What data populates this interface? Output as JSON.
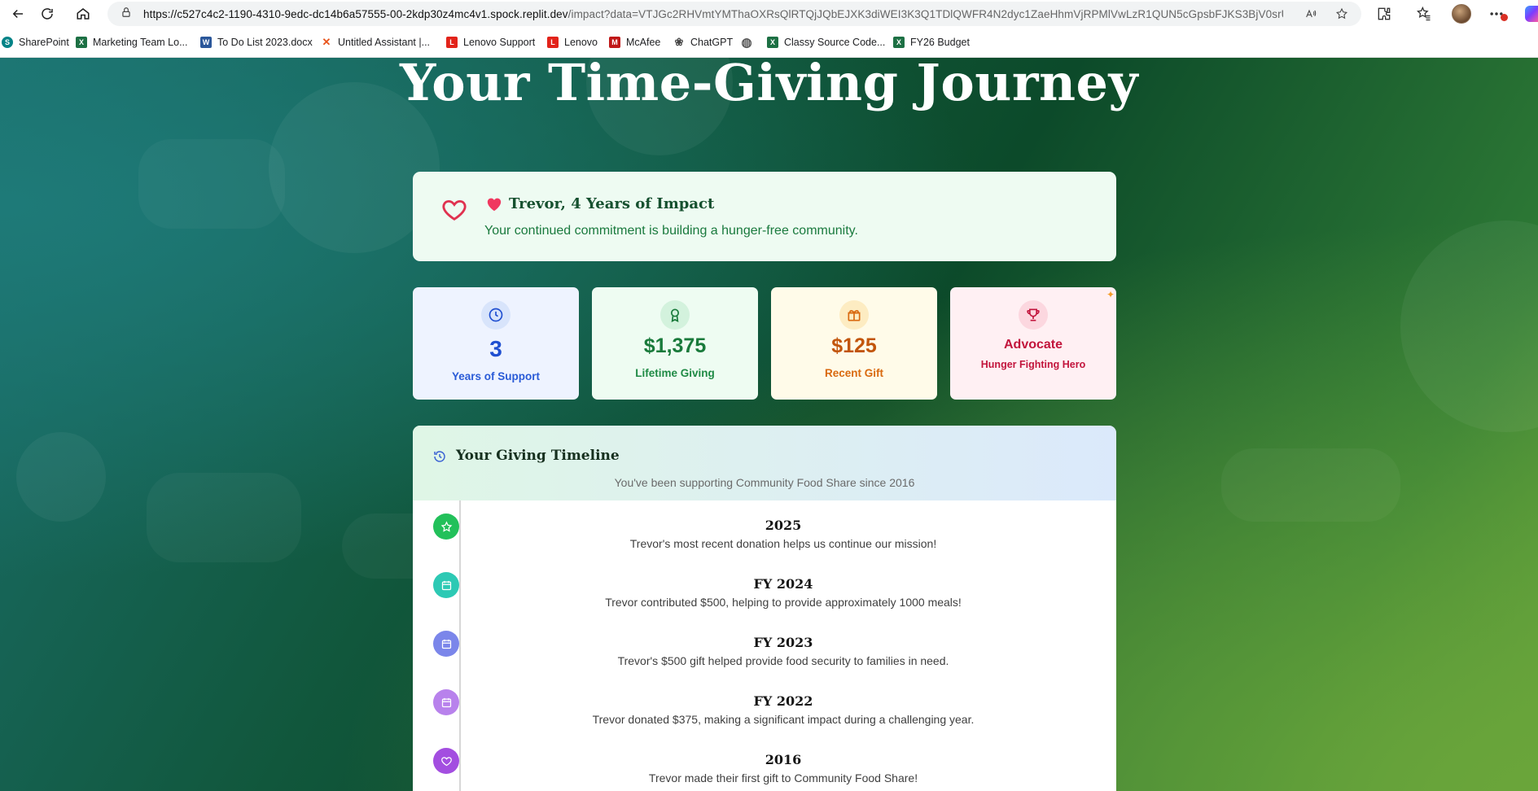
{
  "browser": {
    "url_host": "https://c527c4c2-1190-4310-9edc-dc14b6a57555-00-2kdp30z4mc4v1.spock.replit.dev",
    "url_path": "/impact?data=VTJGc2RHVmtYMThaOXRsQlRTQjJQbEJXK3diWEI3K3Q1TDlQWFR4N2dyc1ZaeHhmVjRPMlVwLzR1QUN5cGpsbFJKS3BjV0srUk..."
  },
  "bookmarks": [
    {
      "label": "SharePoint",
      "icon": "sharepoint-icon",
      "color": "#038387",
      "glyph": "S"
    },
    {
      "label": "Marketing Team Lo...",
      "icon": "excel-icon",
      "color": "#1d7044",
      "glyph": "X"
    },
    {
      "label": "To Do List 2023.docx",
      "icon": "word-icon",
      "color": "#2b579a",
      "glyph": "W"
    },
    {
      "label": "Untitled Assistant |...",
      "icon": "assistant-icon",
      "color": "#e8541c",
      "glyph": "✕"
    },
    {
      "label": "Lenovo Support",
      "icon": "lenovo-icon",
      "color": "#e2231a",
      "glyph": "L"
    },
    {
      "label": "Lenovo",
      "icon": "lenovo-icon",
      "color": "#e2231a",
      "glyph": "L"
    },
    {
      "label": "McAfee",
      "icon": "mcafee-icon",
      "color": "#c01818",
      "glyph": "M"
    },
    {
      "label": "ChatGPT",
      "icon": "chatgpt-icon",
      "color": "#444444",
      "glyph": "❀"
    },
    {
      "label": "",
      "icon": "globe-icon",
      "color": "#555555",
      "glyph": "◍"
    },
    {
      "label": "Classy Source Code...",
      "icon": "excel-icon",
      "color": "#1d7044",
      "glyph": "X"
    },
    {
      "label": "FY26 Budget",
      "icon": "excel-icon",
      "color": "#1d7044",
      "glyph": "X"
    }
  ],
  "hero": {
    "title": "Your Time-Giving Journey"
  },
  "impact": {
    "title": "Trevor, 4 Years of Impact",
    "subtitle": "Your continued commitment is building a hunger-free community."
  },
  "stats": [
    {
      "value": "3",
      "label": "Years of Support",
      "icon": "clock-icon",
      "bg": "#eef3ff",
      "fg": "#1f4fd1",
      "label_color": "#2a5bd7",
      "icon_bg": "#d8e4fb"
    },
    {
      "value": "$1,375",
      "label": "Lifetime Giving",
      "icon": "award-icon",
      "bg": "#eefcf2",
      "fg": "#197a3b",
      "label_color": "#1f8a45",
      "icon_bg": "#d3f2dd"
    },
    {
      "value": "$125",
      "label": "Recent Gift",
      "icon": "gift-icon",
      "bg": "#fffbe9",
      "fg": "#c2550c",
      "label_color": "#d9690f",
      "icon_bg": "#fdecc2"
    },
    {
      "value": "Advocate",
      "label": "Hunger Fighting Hero",
      "icon": "trophy-icon",
      "bg": "#fff0f3",
      "fg": "#c2153c",
      "label_color": "#c2153c",
      "icon_bg": "#fcd7df"
    }
  ],
  "timeline": {
    "title": "Your Giving Timeline",
    "subtitle": "You've been supporting Community Food Share since 2016",
    "items": [
      {
        "year": "2025",
        "text": "Trevor's most recent donation helps us continue our mission!",
        "icon": "star-icon",
        "color": "#22c05a"
      },
      {
        "year": "FY 2024",
        "text": "Trevor contributed $500, helping to provide approximately 1000 meals!",
        "icon": "calendar-icon",
        "color": "#2dc9b4"
      },
      {
        "year": "FY 2023",
        "text": "Trevor's $500 gift helped provide food security to families in need.",
        "icon": "calendar-icon",
        "color": "#7b86ea"
      },
      {
        "year": "FY 2022",
        "text": "Trevor donated $375, making a significant impact during a challenging year.",
        "icon": "calendar-icon",
        "color": "#b882ec"
      },
      {
        "year": "2016",
        "text": "Trevor made their first gift to Community Food Share!",
        "icon": "heart-icon",
        "color": "#a34ee0"
      }
    ]
  }
}
